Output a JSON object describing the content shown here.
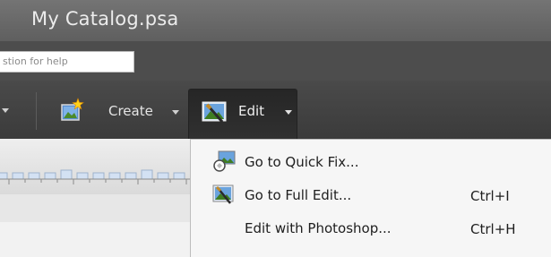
{
  "window": {
    "title": "My Catalog.psa"
  },
  "help": {
    "placeholder_visible": "stion for help"
  },
  "toolbar": {
    "create": {
      "label": "Create",
      "icon": "create-star-icon"
    },
    "edit": {
      "label": "Edit",
      "icon": "edit-photo-icon"
    }
  },
  "edit_menu": {
    "items": [
      {
        "label": "Go to Quick Fix...",
        "shortcut": "",
        "icon": "quick-fix-icon"
      },
      {
        "label": "Go to Full Edit...",
        "shortcut": "Ctrl+I",
        "icon": "full-edit-icon"
      },
      {
        "label": "Edit with Photoshop...",
        "shortcut": "Ctrl+H",
        "icon": ""
      }
    ]
  },
  "colors": {
    "titlebar": "#6a6a6a",
    "toolbar": "#404040",
    "menu_bg": "#f6f6f6",
    "text_light": "#e4e4e4"
  }
}
